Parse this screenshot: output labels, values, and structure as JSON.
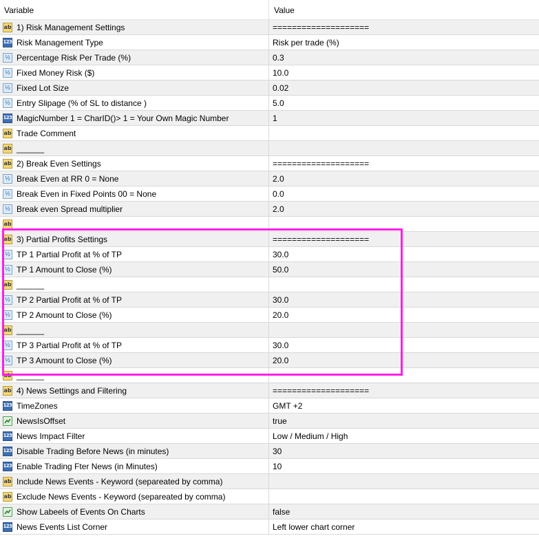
{
  "header": {
    "variable": "Variable",
    "value": "Value"
  },
  "colors": {
    "highlight": "#ff1de8"
  },
  "rows": [
    {
      "icon": "ab-icon",
      "name": "1) Risk Management Settings",
      "value": "===================="
    },
    {
      "icon": "123-icon",
      "name": "Risk Management Type",
      "value": "Risk per trade (%)"
    },
    {
      "icon": "fraction-icon",
      "name": "Percentage Risk Per Trade (%)",
      "value": "0.3"
    },
    {
      "icon": "fraction-icon",
      "name": "Fixed Money Risk ($)",
      "value": "10.0"
    },
    {
      "icon": "fraction-icon",
      "name": "Fixed Lot Size",
      "value": "0.02"
    },
    {
      "icon": "fraction-icon",
      "name": "Entry Slipage (% of SL to distance )",
      "value": "5.0"
    },
    {
      "icon": "123-icon",
      "name": "MagicNumber 1 = CharID()> 1 = Your Own Magic Number",
      "value": "1"
    },
    {
      "icon": "ab-icon",
      "name": "Trade Comment",
      "value": ""
    },
    {
      "icon": "ab-icon",
      "name": "______",
      "value": ""
    },
    {
      "icon": "ab-icon",
      "name": "2) Break Even Settings",
      "value": "===================="
    },
    {
      "icon": "fraction-icon",
      "name": "Break Even at RR 0 = None",
      "value": "2.0"
    },
    {
      "icon": "fraction-icon",
      "name": "Break Even in Fixed Points 00 = None",
      "value": "0.0"
    },
    {
      "icon": "fraction-icon",
      "name": "Break even Spread multiplier",
      "value": "2.0"
    },
    {
      "icon": "ab-icon",
      "name": "",
      "value": ""
    },
    {
      "icon": "ab-icon",
      "name": "3) Partial Profits Settings",
      "value": "===================="
    },
    {
      "icon": "fraction-icon",
      "name": "TP 1 Partial Profit at  % of TP",
      "value": "30.0"
    },
    {
      "icon": "fraction-icon",
      "name": "TP 1 Amount to Close (%)",
      "value": "50.0"
    },
    {
      "icon": "ab-icon",
      "name": "______",
      "value": ""
    },
    {
      "icon": "fraction-icon",
      "name": "TP 2 Partial Profit at  % of TP",
      "value": "30.0"
    },
    {
      "icon": "fraction-icon",
      "name": "TP 2 Amount to Close (%)",
      "value": "20.0"
    },
    {
      "icon": "ab-icon",
      "name": "______",
      "value": ""
    },
    {
      "icon": "fraction-icon",
      "name": "TP 3 Partial Profit at  % of TP",
      "value": "30.0"
    },
    {
      "icon": "fraction-icon",
      "name": "TP 3 Amount to Close (%)",
      "value": "20.0"
    },
    {
      "icon": "ab-icon",
      "name": "______",
      "value": ""
    },
    {
      "icon": "ab-icon",
      "name": "4) News Settings and Filtering",
      "value": "===================="
    },
    {
      "icon": "123-icon",
      "name": "TimeZones",
      "value": "GMT +2"
    },
    {
      "icon": "bool-icon",
      "name": "NewsIsOffset",
      "value": "true"
    },
    {
      "icon": "123-icon",
      "name": "News Impact Filter",
      "value": "Low / Medium / High"
    },
    {
      "icon": "123-icon",
      "name": "Disable Trading Before News (in minutes)",
      "value": "30"
    },
    {
      "icon": "123-icon",
      "name": "Enable Trading Fter News (in Minutes)",
      "value": "10"
    },
    {
      "icon": "ab-icon",
      "name": "Include News Events - Keyword (separeated by comma)",
      "value": ""
    },
    {
      "icon": "ab-icon",
      "name": "Exclude News Events - Keyword (separeated by comma)",
      "value": ""
    },
    {
      "icon": "bool-icon",
      "name": "Show Labeels of Events On Charts",
      "value": "false"
    },
    {
      "icon": "123-icon",
      "name": "News Events List Corner",
      "value": "Left lower chart corner"
    }
  ]
}
